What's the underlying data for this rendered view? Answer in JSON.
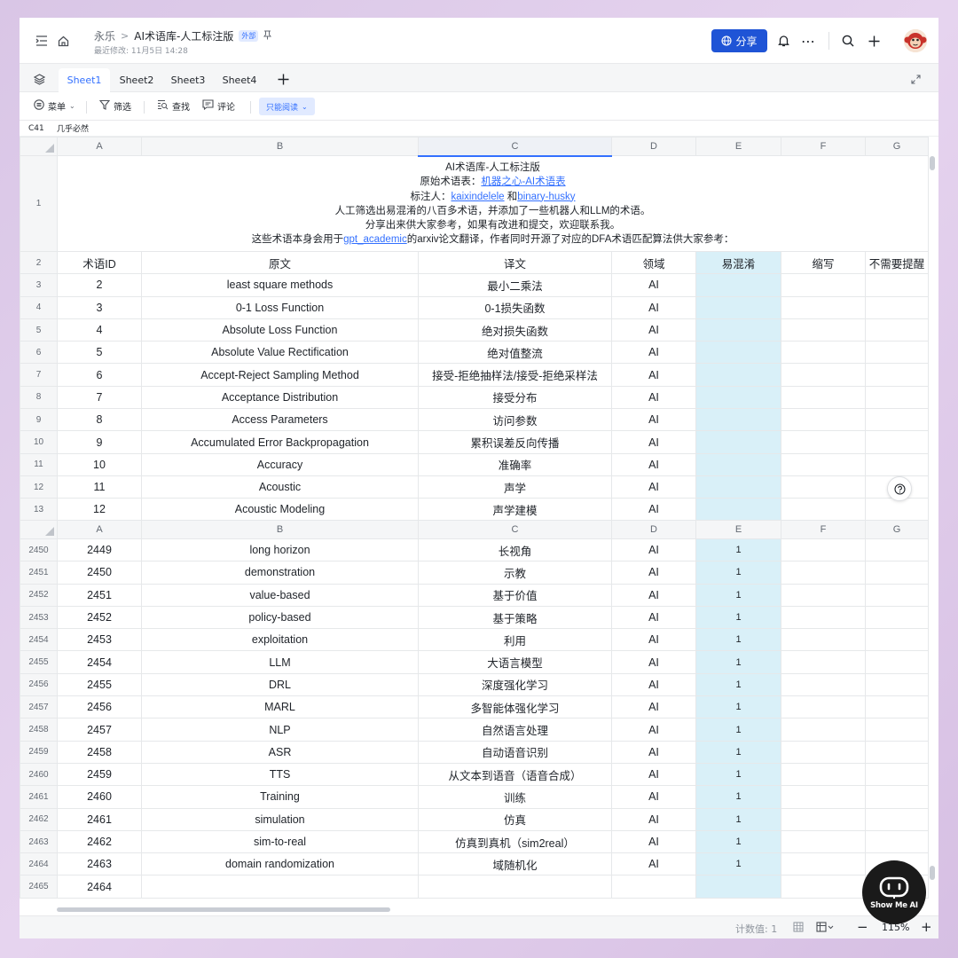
{
  "header": {
    "breadcrumb_root": "永乐",
    "breadcrumb_sep": ">",
    "doc_title": "AI术语库-人工标注版",
    "external_badge": "外部",
    "last_modified": "最近修改: 11月5日 14:28",
    "share_label": "分享"
  },
  "tabs": [
    "Sheet1",
    "Sheet2",
    "Sheet3",
    "Sheet4"
  ],
  "toolbar": {
    "menu_label": "菜单",
    "filter_label": "筛选",
    "find_label": "查找",
    "comment_label": "评论",
    "readonly_label": "只能阅读"
  },
  "formula_bar": {
    "cell_ref": "C41",
    "cell_value": "几乎必然"
  },
  "columns": [
    "A",
    "B",
    "C",
    "D",
    "E",
    "F",
    "G"
  ],
  "intro": {
    "row_number": "1",
    "line1": "AI术语库-人工标注版",
    "line2_prefix": "原始术语表：",
    "line2_link": "机器之心-AI术语表",
    "line3_prefix": "标注人：",
    "line3_link1": "kaixindelele",
    "line3_mid": " 和",
    "line3_link2": "binary-husky",
    "line4": "人工筛选出易混淆的八百多术语，并添加了一些机器人和LLM的术语。",
    "line5": "分享出来供大家参考，如果有改进和提交，欢迎联系我。",
    "line6_prefix": "这些术语本身会用于",
    "line6_link": "gpt_academic",
    "line6_suffix": "的arxiv论文翻译，作者同时开源了对应的DFA术语匹配算法供大家参考："
  },
  "header_row": {
    "row_number": "2",
    "cells": [
      "术语ID",
      "原文",
      "译文",
      "领域",
      "易混淆",
      "缩写",
      "不需要提醒"
    ]
  },
  "top_rows": [
    {
      "rn": "3",
      "id": "2",
      "en": "least square methods",
      "zh": "最小二乘法",
      "domain": "AI",
      "conf": ""
    },
    {
      "rn": "4",
      "id": "3",
      "en": "0-1 Loss Function",
      "zh": "0-1损失函数",
      "domain": "AI",
      "conf": ""
    },
    {
      "rn": "5",
      "id": "4",
      "en": "Absolute Loss Function",
      "zh": "绝对损失函数",
      "domain": "AI",
      "conf": ""
    },
    {
      "rn": "6",
      "id": "5",
      "en": "Absolute Value Rectification",
      "zh": "绝对值整流",
      "domain": "AI",
      "conf": ""
    },
    {
      "rn": "7",
      "id": "6",
      "en": "Accept-Reject Sampling Method",
      "zh": "接受-拒绝抽样法/接受-拒绝采样法",
      "domain": "AI",
      "conf": ""
    },
    {
      "rn": "8",
      "id": "7",
      "en": "Acceptance Distribution",
      "zh": "接受分布",
      "domain": "AI",
      "conf": ""
    },
    {
      "rn": "9",
      "id": "8",
      "en": "Access Parameters",
      "zh": "访问参数",
      "domain": "AI",
      "conf": ""
    },
    {
      "rn": "10",
      "id": "9",
      "en": "Accumulated Error Backpropagation",
      "zh": "累积误差反向传播",
      "domain": "AI",
      "conf": ""
    },
    {
      "rn": "11",
      "id": "10",
      "en": "Accuracy",
      "zh": "准确率",
      "domain": "AI",
      "conf": ""
    },
    {
      "rn": "12",
      "id": "11",
      "en": "Acoustic",
      "zh": "声学",
      "domain": "AI",
      "conf": ""
    },
    {
      "rn": "13",
      "id": "12",
      "en": "Acoustic Modeling",
      "zh": "声学建模",
      "domain": "AI",
      "conf": ""
    }
  ],
  "bottom_rows": [
    {
      "rn": "2450",
      "id": "2449",
      "en": "long horizon",
      "zh": "长视角",
      "domain": "AI",
      "conf": "1"
    },
    {
      "rn": "2451",
      "id": "2450",
      "en": "demonstration",
      "zh": "示教",
      "domain": "AI",
      "conf": "1"
    },
    {
      "rn": "2452",
      "id": "2451",
      "en": "value-based",
      "zh": "基于价值",
      "domain": "AI",
      "conf": "1"
    },
    {
      "rn": "2453",
      "id": "2452",
      "en": "policy-based",
      "zh": "基于策略",
      "domain": "AI",
      "conf": "1"
    },
    {
      "rn": "2454",
      "id": "2453",
      "en": "exploitation",
      "zh": "利用",
      "domain": "AI",
      "conf": "1"
    },
    {
      "rn": "2455",
      "id": "2454",
      "en": "LLM",
      "zh": "大语言模型",
      "domain": "AI",
      "conf": "1"
    },
    {
      "rn": "2456",
      "id": "2455",
      "en": "DRL",
      "zh": "深度强化学习",
      "domain": "AI",
      "conf": "1"
    },
    {
      "rn": "2457",
      "id": "2456",
      "en": "MARL",
      "zh": "多智能体强化学习",
      "domain": "AI",
      "conf": "1"
    },
    {
      "rn": "2458",
      "id": "2457",
      "en": "NLP",
      "zh": "自然语言处理",
      "domain": "AI",
      "conf": "1"
    },
    {
      "rn": "2459",
      "id": "2458",
      "en": "ASR",
      "zh": "自动语音识别",
      "domain": "AI",
      "conf": "1"
    },
    {
      "rn": "2460",
      "id": "2459",
      "en": "TTS",
      "zh": "从文本到语音（语音合成）",
      "domain": "AI",
      "conf": "1"
    },
    {
      "rn": "2461",
      "id": "2460",
      "en": "Training",
      "zh": "训练",
      "domain": "AI",
      "conf": "1"
    },
    {
      "rn": "2462",
      "id": "2461",
      "en": "simulation",
      "zh": "仿真",
      "domain": "AI",
      "conf": "1"
    },
    {
      "rn": "2463",
      "id": "2462",
      "en": "sim-to-real",
      "zh": "仿真到真机（sim2real）",
      "domain": "AI",
      "conf": "1"
    },
    {
      "rn": "2464",
      "id": "2463",
      "en": "domain randomization",
      "zh": "域随机化",
      "domain": "AI",
      "conf": "1"
    },
    {
      "rn": "2465",
      "id": "2464",
      "en": "",
      "zh": "",
      "domain": "",
      "conf": ""
    }
  ],
  "status": {
    "count_label": "计数值: 1",
    "zoom": "115%"
  },
  "watermark": "Show Me AI",
  "colors": {
    "accent": "#3370ff",
    "share_bg": "#1f54d6",
    "confusable_col_bg": "#d9f0f8",
    "background": "#dcc8e8"
  }
}
